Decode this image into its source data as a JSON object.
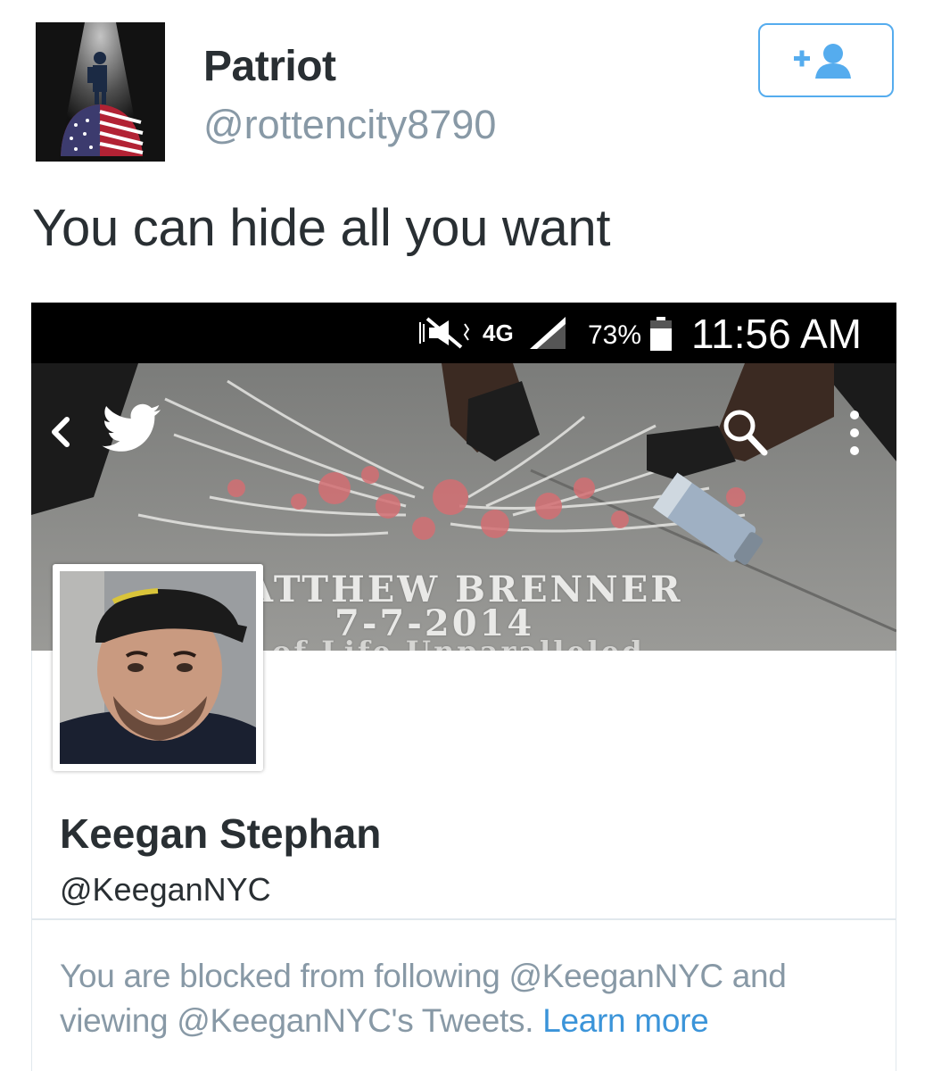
{
  "tweet": {
    "author_name": "Patriot",
    "author_handle": "@rottencity8790",
    "text": "You can hide all you want",
    "follow_icon": "add-user-icon",
    "accent_color": "#55acee"
  },
  "embedded_screenshot": {
    "status_bar": {
      "network": "4G",
      "battery": "73%",
      "time": "11:56 AM"
    },
    "banner": {
      "memorial_name": "ATTHEW BRENNER",
      "memorial_date": "7-7-2014",
      "memorial_partial": "of Life Unparalleled"
    },
    "nav_icons": [
      "back-icon",
      "twitter-bird-icon",
      "search-icon",
      "more-options-icon"
    ],
    "profile": {
      "name": "Keegan Stephan",
      "handle": "@KeeganNYC"
    },
    "block_notice": {
      "text": "You are blocked from following @KeeganNYC and viewing @KeeganNYC's Tweets.",
      "link_text": "Learn more",
      "link_color": "#3b94d9"
    }
  }
}
